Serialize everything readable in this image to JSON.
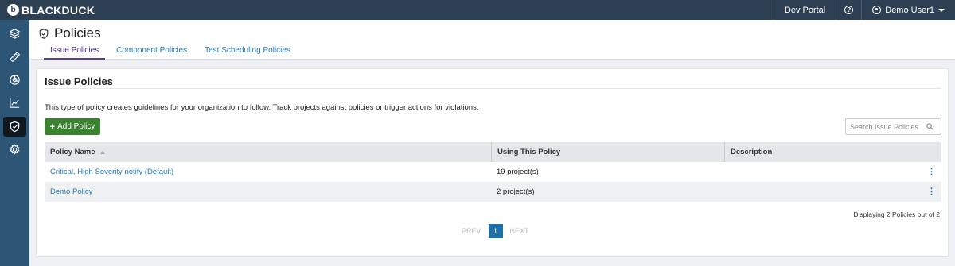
{
  "header": {
    "logo_mark": "b",
    "logo_text": "BLACKDUCK",
    "dev_portal": "Dev Portal",
    "help_glyph": "?",
    "user_name": "Demo User1"
  },
  "sidebar": {
    "items": [
      {
        "icon": "layers-icon",
        "active": false
      },
      {
        "icon": "ruler-icon",
        "active": false
      },
      {
        "icon": "radar-icon",
        "active": false
      },
      {
        "icon": "trend-chart-icon",
        "active": false
      },
      {
        "icon": "shield-check-icon",
        "active": true
      },
      {
        "icon": "gear-icon",
        "active": false
      }
    ]
  },
  "page": {
    "title": "Policies",
    "tabs": [
      {
        "label": "Issue Policies",
        "active": true
      },
      {
        "label": "Component Policies",
        "active": false
      },
      {
        "label": "Test Scheduling Policies",
        "active": false
      }
    ]
  },
  "card": {
    "title": "Issue Policies",
    "description": "This type of policy creates guidelines for your organization to follow. Track projects against policies or trigger actions for violations.",
    "add_button": "Add Policy",
    "search_placeholder": "Search Issue Policies"
  },
  "table": {
    "columns": [
      "Policy Name",
      "Using This Policy",
      "Description"
    ],
    "rows": [
      {
        "name": "Critical, High Severity notify (Default)",
        "using": "19 project(s)",
        "description": ""
      },
      {
        "name": "Demo Policy",
        "using": "2 project(s)",
        "description": ""
      }
    ]
  },
  "footer": {
    "displaying": "Displaying 2 Policies out of 2",
    "prev": "PREV",
    "page": "1",
    "next": "NEXT"
  },
  "colors": {
    "topbar": "#2d3f52",
    "sidebar": "#2d5576",
    "accent_link": "#1f78b4",
    "add_button": "#3b8230",
    "active_tab": "#5c3b9e"
  }
}
